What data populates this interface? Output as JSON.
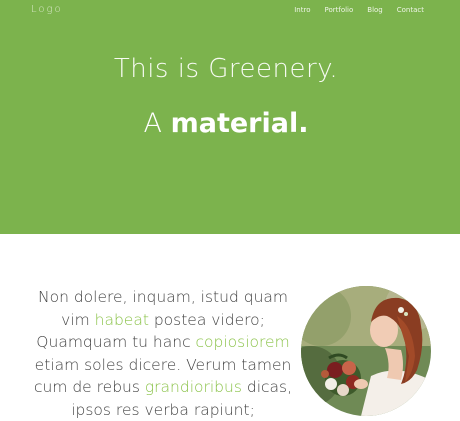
{
  "header": {
    "logo": "Logo",
    "nav": [
      "Intro",
      "Portfolio",
      "Blog",
      "Contact"
    ]
  },
  "hero": {
    "line1": "This is Greenery.",
    "line2_lead": "A",
    "line2_strong": "material."
  },
  "content": {
    "l1": "Non dolere, inquam, istud quam",
    "l2_pre": "vim ",
    "l2_hl": "habeat",
    "l2_post": " postea videro;",
    "l3_pre": "Quamquam tu hanc ",
    "l3_hl": "copiosiorem",
    "l4": "etiam soles dicere. Verum tamen",
    "l5_pre": "cum de rebus ",
    "l5_hl": "grandioribus",
    "l5_post": " dicas,",
    "l6": "ipsos res verba rapiunt;"
  },
  "colors": {
    "hero_bg": "#7cb34d",
    "accent": "#8bc34a",
    "text": "#444444"
  },
  "image": {
    "icon": "bride-with-bouquet-photo"
  }
}
